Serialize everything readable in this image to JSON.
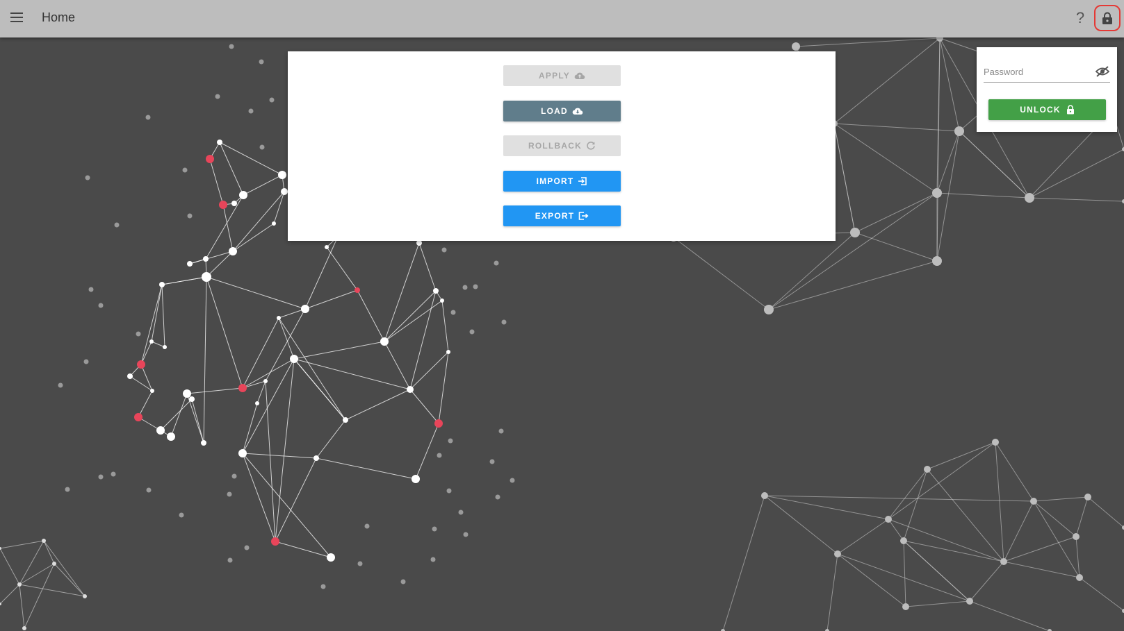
{
  "header": {
    "title": "Home",
    "menu_icon": "hamburger-menu-icon",
    "help_label": "?",
    "lock_icon": "lock-icon"
  },
  "actions": [
    {
      "label": "APPLY",
      "icon": "cloud-upload-icon",
      "state": "disabled"
    },
    {
      "label": "LOAD",
      "icon": "cloud-download-icon",
      "state": "enabled"
    },
    {
      "label": "ROLLBACK",
      "icon": "refresh-icon",
      "state": "disabled"
    },
    {
      "label": "IMPORT",
      "icon": "import-icon",
      "state": "enabled"
    },
    {
      "label": "EXPORT",
      "icon": "export-icon",
      "state": "enabled"
    }
  ],
  "unlock": {
    "password_placeholder": "Password",
    "password_value": "",
    "visibility_icon": "eye-off-icon",
    "button_label": "UNLOCK",
    "button_icon": "lock-icon"
  },
  "colors": {
    "background": "#4a4a4a",
    "topbar": "#bdbdbd",
    "load_button": "#607d8b",
    "primary_button": "#2196f3",
    "unlock_button": "#43a047",
    "highlight": "#e53935",
    "node_accent": "#e8455a"
  }
}
